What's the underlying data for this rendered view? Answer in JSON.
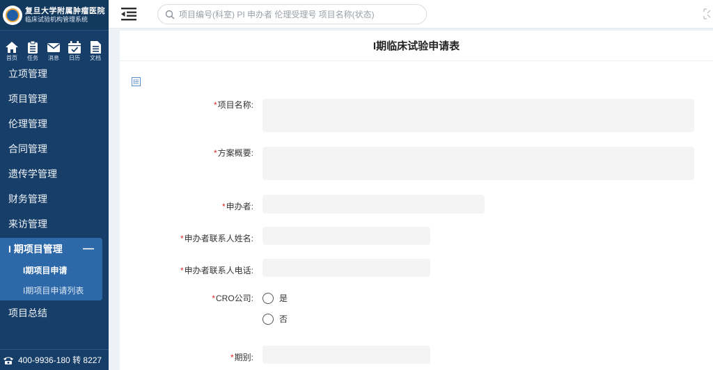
{
  "app": {
    "name": "复旦大学附属肿瘤医院",
    "subtitle": "临床试验机构管理系统"
  },
  "shortcuts": [
    {
      "label": "首页",
      "icon": "home-icon"
    },
    {
      "label": "任务",
      "icon": "task-icon"
    },
    {
      "label": "消息",
      "icon": "mail-icon"
    },
    {
      "label": "日历",
      "icon": "calendar-icon"
    },
    {
      "label": "文档",
      "icon": "document-icon"
    }
  ],
  "menu": {
    "items": [
      "立项管理",
      "项目管理",
      "伦理管理",
      "合同管理",
      "遗传学管理",
      "财务管理",
      "来访管理"
    ],
    "group": {
      "label": "I 期项目管理",
      "collapse_symbol": "—",
      "children": [
        "I期项目申请",
        "I期项目申请列表"
      ],
      "active_child": "I期项目申请"
    },
    "after": [
      "项目总结"
    ]
  },
  "phone": "400-9936-180 转 8227",
  "header": {
    "search_placeholder": "项目编号(科室) PI 申办者 伦理受理号 项目名称(状态)"
  },
  "form": {
    "title": "I期临床试验申请表",
    "required_mark": "*",
    "fields": {
      "project_name": {
        "label": "项目名称:",
        "value": ""
      },
      "protocol_summary": {
        "label": "方案概要:",
        "value": ""
      },
      "sponsor": {
        "label": "申办者:",
        "value": ""
      },
      "sponsor_contact_name": {
        "label": "申办者联系人姓名:",
        "value": ""
      },
      "sponsor_contact_phone": {
        "label": "申办者联系人电话:",
        "value": ""
      },
      "cro": {
        "label": "CRO公司:",
        "options": [
          "是",
          "否"
        ],
        "selected": null
      },
      "phase": {
        "label": "期别:",
        "value": ""
      }
    }
  },
  "colors": {
    "sidebar": "#163e68",
    "sidebar_active_group": "#2d68a8",
    "required": "#e02424",
    "input_bg": "#f4f4f4"
  }
}
